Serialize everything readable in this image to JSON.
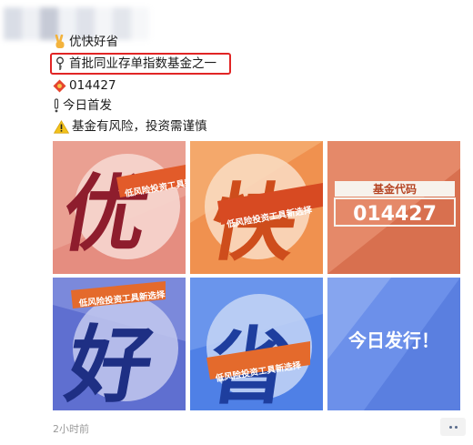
{
  "post": {
    "lines": [
      {
        "icon": "victory-hand-icon",
        "text": "优快好省"
      },
      {
        "icon": "pin-icon",
        "text": "首批同业存单指数基金之一"
      },
      {
        "icon": "red-packet-icon",
        "text": "014427"
      },
      {
        "icon": "exclamation-icon",
        "text": "今日首发"
      },
      {
        "icon": "warning-icon",
        "text": "基金有风险，投资需谨慎"
      }
    ],
    "timestamp": "2小时前"
  },
  "images": {
    "tile1": {
      "big": "优",
      "banner": "低风险投资工具新选择"
    },
    "tile2": {
      "big": "快",
      "banner": "低风险投资工具新选择"
    },
    "tile3": {
      "label": "基金代码",
      "code": "014427"
    },
    "tile4": {
      "big": "好",
      "banner": "低风险投资工具新选择"
    },
    "tile5": {
      "big": "省",
      "banner": "低风险投资工具新选择"
    },
    "tile6": {
      "text": "今日发行！"
    }
  },
  "colors": {
    "highlight_border": "#e12525",
    "tile1_bg": "#e58d80",
    "tile2_bg": "#f0914f",
    "tile3_bg": "#d8704f",
    "tile4_bg": "#5f6fd0",
    "tile5_bg": "#4f80e6",
    "tile6_bg": "#6c90ea"
  }
}
